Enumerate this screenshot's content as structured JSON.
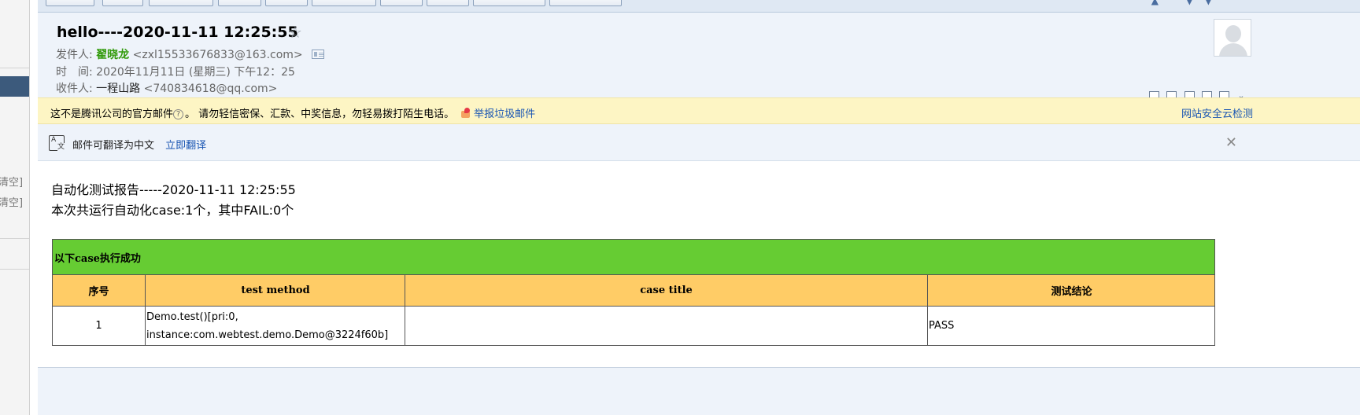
{
  "sidebar": {
    "clear_labels": [
      "清空]",
      "清空]"
    ]
  },
  "email": {
    "subject": "hello----2020-11-11 12:25:55",
    "from_label": "发件人:",
    "from_name": "翟晓龙",
    "from_address": "<zxl15533676833@163.com>",
    "time_label": "时　间:",
    "time_value": "2020年11月11日 (星期三) 下午12：25",
    "to_label": "收件人:",
    "to_name": "一程山路",
    "to_address": "<740834618@qq.com>"
  },
  "warning": {
    "text": "这不是腾讯公司的官方邮件",
    "text2": "。  请勿轻信密保、汇款、中奖信息，勿轻易拨打陌生电话。",
    "report_link": "举报垃圾邮件",
    "right_link": "网站安全云检测"
  },
  "translate": {
    "text": "邮件可翻译为中文",
    "link": "立即翻译"
  },
  "content": {
    "line1": "自动化测试报告-----2020-11-11 12:25:55",
    "line2": "本次共运行自动化case:1个，其中FAIL:0个",
    "table": {
      "banner": "以下case执行成功",
      "headers": [
        "序号",
        "test method",
        "case title",
        "测试结论"
      ],
      "rows": [
        {
          "index": "1",
          "method_line1": "Demo.test()[pri:0,",
          "method_line2": "instance:com.webtest.demo.Demo@3224f60b]",
          "title": "",
          "result": "PASS"
        }
      ]
    }
  },
  "colors": {
    "banner_green": "#66cc33",
    "header_orange": "#ffcc66",
    "warning_yellow": "#fdf5c4",
    "link_blue": "#1a56b3",
    "sender_green": "#319a0a"
  }
}
